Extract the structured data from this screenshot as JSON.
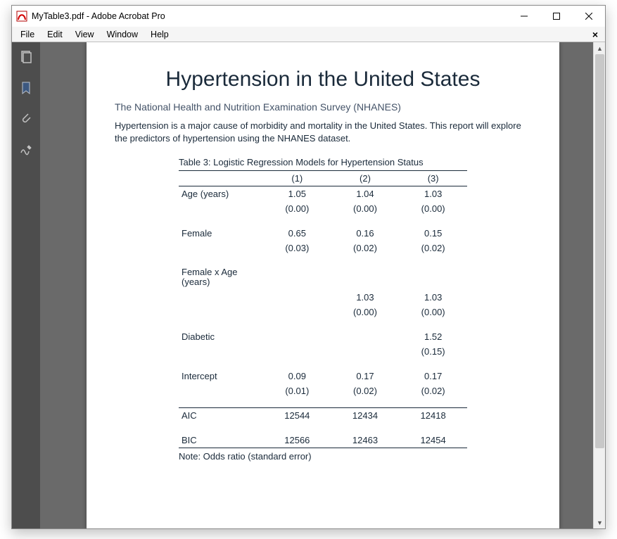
{
  "window": {
    "title": "MyTable3.pdf - Adobe Acrobat Pro"
  },
  "menubar": {
    "items": [
      "File",
      "Edit",
      "View",
      "Window",
      "Help"
    ]
  },
  "sidebar": {
    "icons": [
      "pages-panel-icon",
      "bookmarks-panel-icon",
      "attachments-panel-icon",
      "signatures-panel-icon"
    ]
  },
  "document": {
    "title": "Hypertension in the United States",
    "subtitle": "The National Health and Nutrition Examination Survey (NHANES)",
    "paragraph": "Hypertension is a major cause of morbidity and mortality in the United States.  This report will explore the predictors of hypertension using the NHANES dataset.",
    "table": {
      "caption": "Table 3: Logistic Regression Models for Hypertension Status",
      "col_headers": [
        "(1)",
        "(2)",
        "(3)"
      ],
      "rows": [
        {
          "label": "Age (years)",
          "coef": [
            "1.05",
            "1.04",
            "1.03"
          ],
          "se": [
            "(0.00)",
            "(0.00)",
            "(0.00)"
          ]
        },
        {
          "label": "Female",
          "coef": [
            "0.65",
            "0.16",
            "0.15"
          ],
          "se": [
            "(0.03)",
            "(0.02)",
            "(0.02)"
          ]
        },
        {
          "label": "Female x Age (years)",
          "coef": [
            "",
            "1.03",
            "1.03"
          ],
          "se": [
            "",
            "(0.00)",
            "(0.00)"
          ]
        },
        {
          "label": "Diabetic",
          "coef": [
            "",
            "",
            "1.52"
          ],
          "se": [
            "",
            "",
            "(0.15)"
          ]
        },
        {
          "label": "Intercept",
          "coef": [
            "0.09",
            "0.17",
            "0.17"
          ],
          "se": [
            "(0.01)",
            "(0.02)",
            "(0.02)"
          ]
        }
      ],
      "stats": [
        {
          "label": "AIC",
          "vals": [
            "12544",
            "12434",
            "12418"
          ]
        },
        {
          "label": "BIC",
          "vals": [
            "12566",
            "12463",
            "12454"
          ]
        }
      ],
      "note": "Note: Odds ratio (standard error)"
    }
  }
}
